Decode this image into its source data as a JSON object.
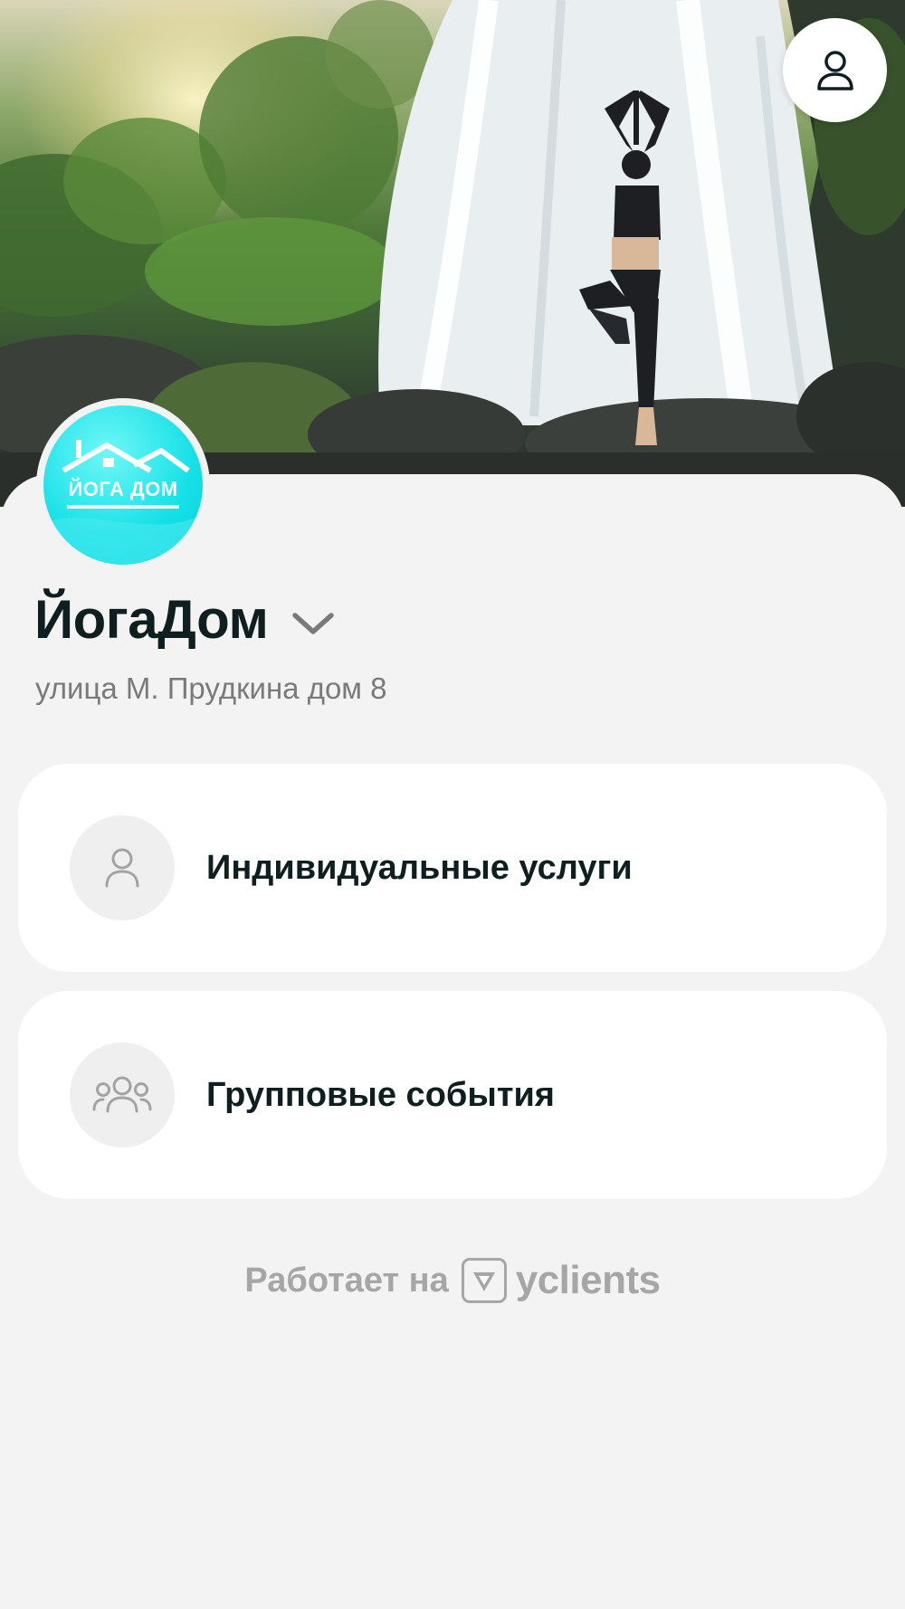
{
  "hero": {
    "image_alt": "Yoga pose in front of waterfall"
  },
  "header": {
    "profile_icon": "user-icon"
  },
  "company": {
    "logo_text": "ЙОГА ДОМ",
    "name": "ЙогаДом",
    "address": "улица М. Прудкина дом 8",
    "dropdown_icon": "chevron-down-icon"
  },
  "menu": {
    "items": [
      {
        "label": "Индивидуальные услуги",
        "icon": "user-icon"
      },
      {
        "label": "Групповые события",
        "icon": "group-icon"
      }
    ]
  },
  "footer": {
    "powered_by": "Работает на",
    "brand": "yclients",
    "brand_icon": "yclients-logo-icon"
  },
  "colors": {
    "background": "#f3f3f3",
    "card": "#ffffff",
    "text_primary": "#0f1f1f",
    "text_secondary": "#7a7a7a",
    "footer_text": "#a6a6a6",
    "logo_cyan": "#14e0e6"
  }
}
